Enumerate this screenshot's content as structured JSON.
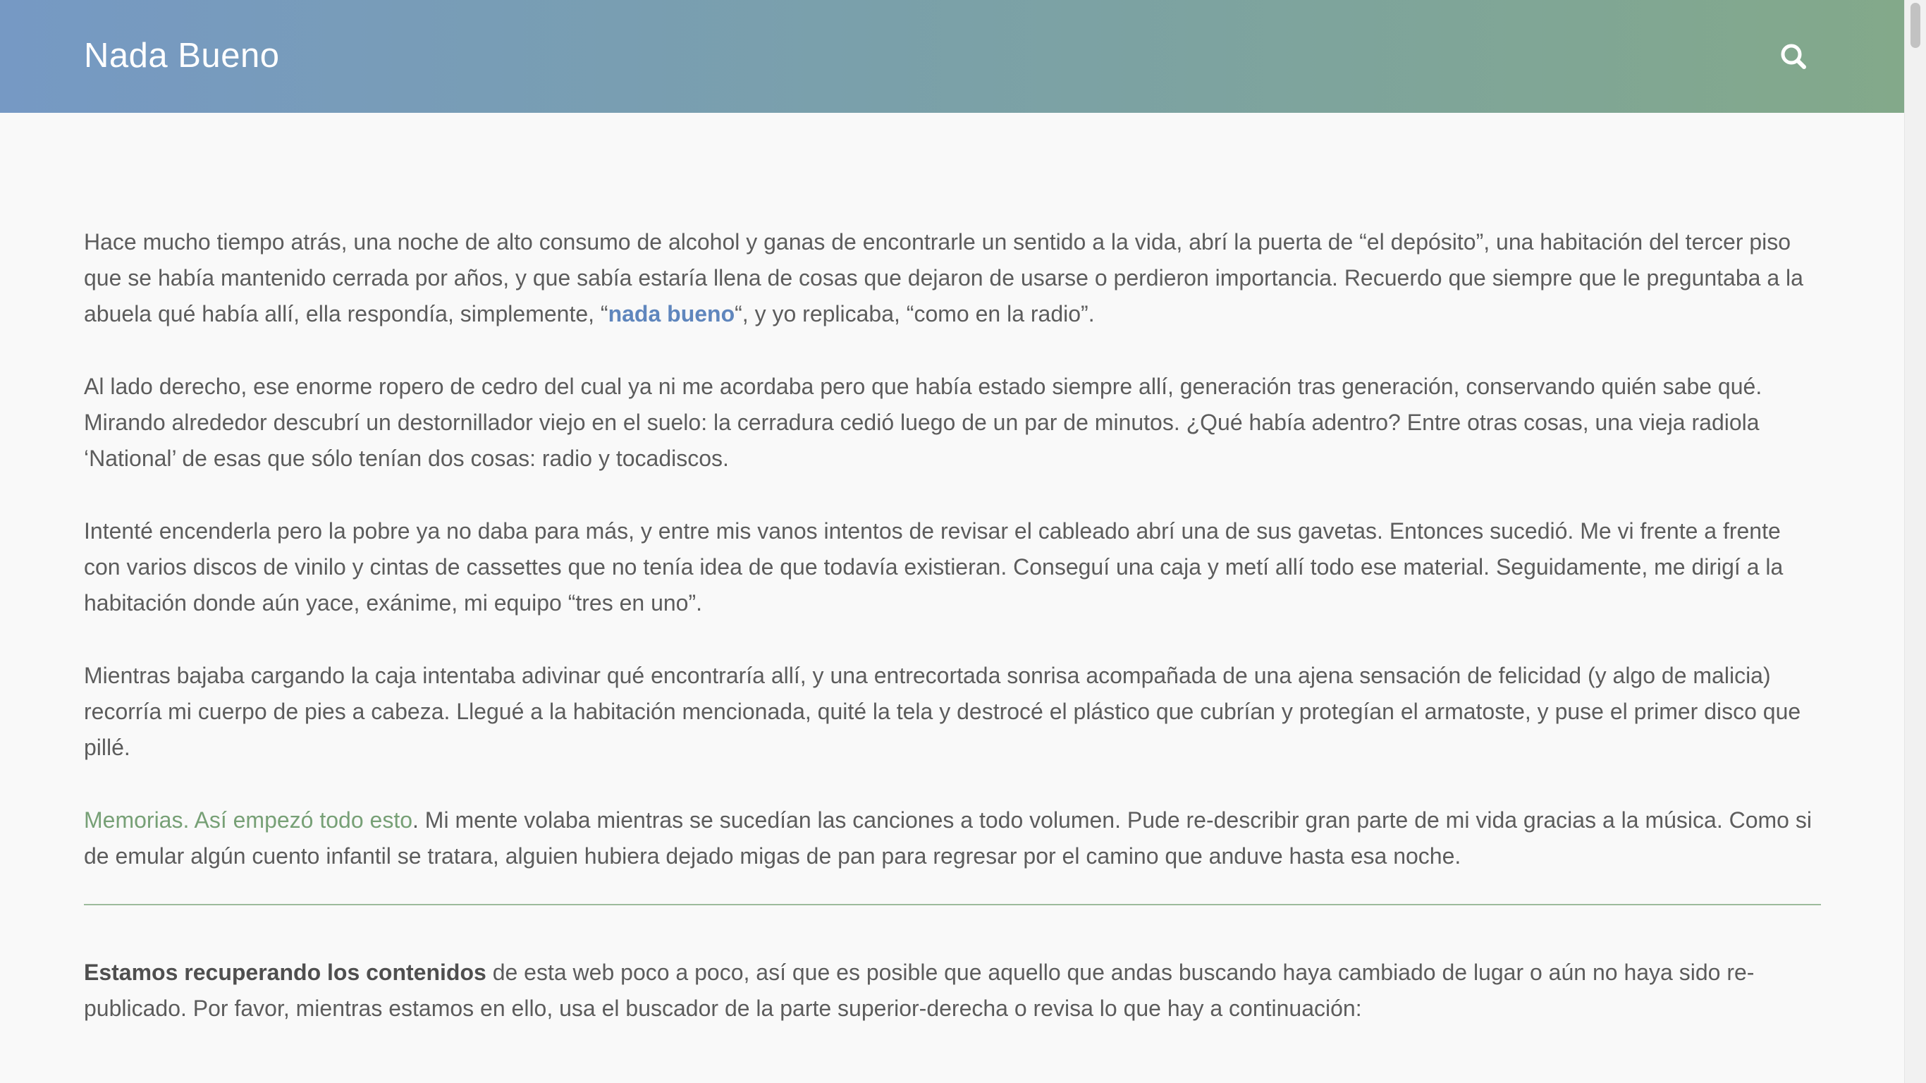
{
  "header": {
    "site_title": "Nada Bueno",
    "search_icon": "search-icon"
  },
  "content": {
    "p1": {
      "before_link": "Hace mucho tiempo atrás, una noche de alto consumo de alcohol y ganas de encontrarle un sentido a la vida, abrí la puerta de “el depósito”, una habitación del tercer piso que se había mantenido cerrada por años, y que sabía estaría llena de cosas que dejaron de usarse o perdieron importancia. Recuerdo que siempre que le preguntaba a la abuela qué había allí, ella respondía, simplemente, “",
      "link": "nada bueno",
      "after_link": "“, y yo replicaba, “como en la radio”."
    },
    "p2": "Al lado derecho, ese enorme ropero de cedro del cual ya ni me acordaba pero que había estado siempre allí, generación tras generación, conservando quién sabe qué. Mirando alrededor descubrí un destornillador viejo en el suelo: la cerradura cedió luego de un par de minutos. ¿Qué había adentro? Entre otras cosas, una vieja radiola ‘National’ de esas que sólo tenían dos cosas: radio y tocadiscos.",
    "p3": "Intenté encenderla pero la pobre ya no daba para más, y entre mis vanos intentos de revisar el cableado abrí una de sus gavetas. Entonces sucedió. Me vi frente a frente con varios discos de vinilo y cintas de cassettes que no tenía idea de que todavía existieran. Conseguí una caja y metí allí todo ese material. Seguidamente, me dirigí a la habitación donde aún yace, exánime, mi equipo “tres en uno”.",
    "p4": "Mientras bajaba cargando la caja intentaba adivinar qué encontraría allí, y una entrecortada sonrisa acompañada de una ajena sensación de felicidad (y algo de malicia) recorría mi cuerpo de pies a cabeza. Llegué a la habitación mencionada, quité la tela y destrocé el plástico que cubrían y protegían el armatoste, y puse el primer disco que pillé.",
    "p5": {
      "link": "Memorias. Así empezó todo esto",
      "after_link": ". Mi mente volaba mientras se sucedían las canciones a todo volumen. Pude re-describir gran parte de mi vida gracias a la música. Como si de emular algún cuento infantil se tratara, alguien hubiera dejado migas de pan para regresar por el camino que anduve hasta esa noche."
    },
    "p6": {
      "strong": "Estamos recuperando los contenidos",
      "rest": " de esta web poco a poco, así que es posible que aquello que andas buscando haya cambiado de lugar o aún no haya sido re-publicado. Por favor, mientras estamos en ello, usa el buscador de la parte superior-derecha o revisa lo que hay a continuación:"
    }
  },
  "colors": {
    "header_gradient_start": "#7699c4",
    "header_gradient_end": "#83a98a",
    "link_blue": "#5f86bd",
    "link_green": "#77a076",
    "text": "#5c5c5c",
    "divider": "#9dbb9c"
  }
}
